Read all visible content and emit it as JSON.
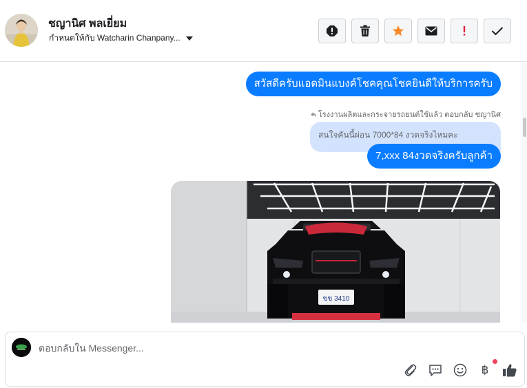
{
  "header": {
    "contact_name": "ชญานิศ พลเยี่ยม",
    "assigned_to": "กำหนดให้กับ Watcharin Chanpany..."
  },
  "messages": {
    "greeting": "สวัสดีครับแอดมินแบงค์โชคคุณโชคยินดีให้บริการครับ",
    "reply_caption": "โรงงานผลิตและกระจายรถยนต์ใช้แล้ว ตอบกลับ ชญานิศ",
    "quoted_text": "สนใจคันนี้ผ่อน 7000*84 งวดจริงไหมคะ",
    "reply_text": "7,xxx 84งวดจริงครับลูกค้า",
    "plate_text": "ขข 3410"
  },
  "composer": {
    "placeholder": "ตอบกลับใน Messenger..."
  },
  "icons": {
    "toolbar": [
      "alert-icon",
      "trash-icon",
      "star-icon",
      "envelope-icon",
      "exclamation-icon",
      "check-icon"
    ],
    "composer": [
      "paperclip-icon",
      "saved-reply-icon",
      "emoji-icon",
      "baht-icon",
      "like-icon"
    ]
  },
  "colors": {
    "bubble_blue": "#0a7cff",
    "quoted_bg": "#d3e3fd",
    "star_orange": "#f78a2b",
    "alert_red": "#e41e3f"
  }
}
